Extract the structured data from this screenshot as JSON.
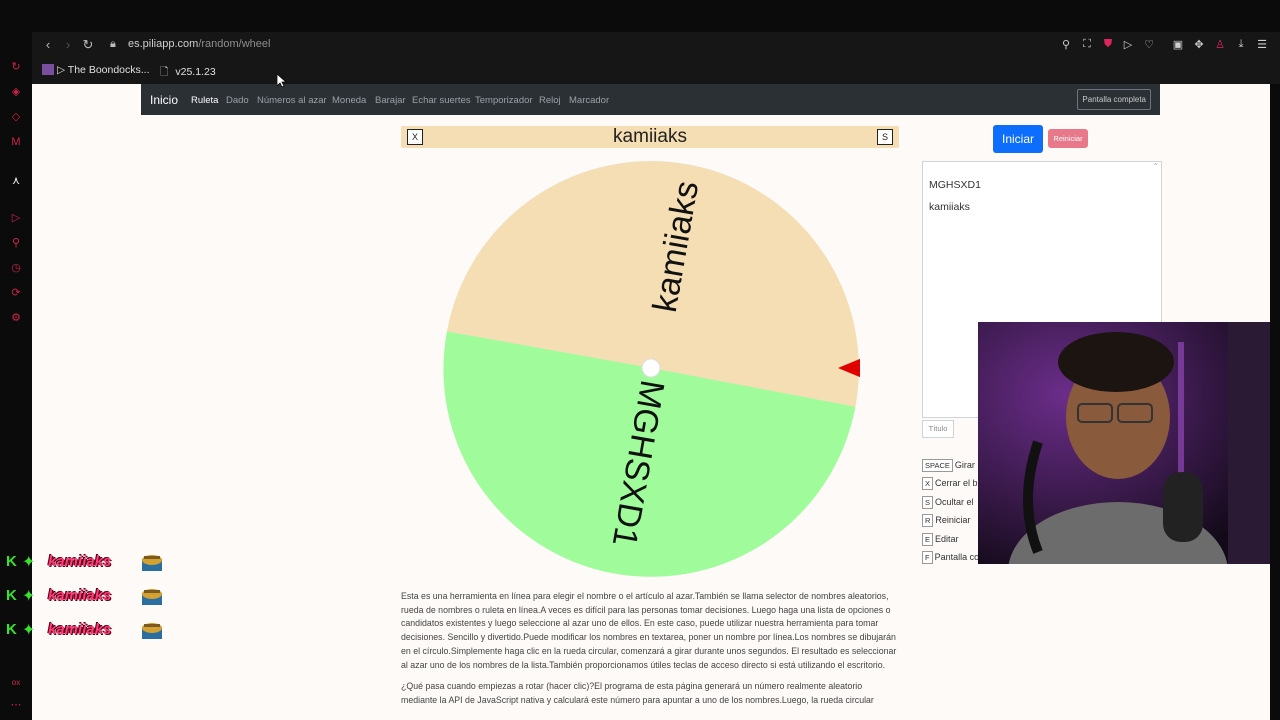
{
  "browser": {
    "url_domain": "es.piliapp.com",
    "url_path": "/random/wheel",
    "bookmarks": [
      {
        "label": "▷ The Boondocks..."
      },
      {
        "label": "v25.1.23"
      }
    ]
  },
  "nav": {
    "brand": "Inicio",
    "links": [
      "Ruleta",
      "Dado",
      "Números al azar",
      "Moneda",
      "Barajar",
      "Echar suertes",
      "Temporizador",
      "Reloj",
      "Marcador"
    ],
    "active": "Ruleta",
    "fullscreen_label": "Pantalla completa"
  },
  "wheel": {
    "title": "kamiiaks",
    "close_key": "X",
    "s_key": "S",
    "segments": [
      {
        "label": "kamiiaks",
        "color": "#f5deb3"
      },
      {
        "label": "MGHSXD1",
        "color": "#a0fc9b"
      }
    ],
    "pointer_color": "#e00000"
  },
  "controls": {
    "start_label": "Iniciar",
    "reset_label": "Reiniciar",
    "names": [
      "MGHSXD1",
      "kamiiaks"
    ],
    "title_placeholder": "Título",
    "shortcuts": [
      {
        "key": "SPACE",
        "label": "Girar"
      },
      {
        "key": "X",
        "label": "Cerrar el b"
      },
      {
        "key": "S",
        "label": "Ocultar el"
      },
      {
        "key": "R",
        "label": "Reiniciar"
      },
      {
        "key": "E",
        "label": "Editar"
      },
      {
        "key": "F",
        "label": "Pantalla co"
      }
    ]
  },
  "description": {
    "p1": "Esta es una herramienta en línea para elegir el nombre o el artículo al azar.También se llama selector de nombres aleatorios, rueda de nombres o ruleta en línea.A veces es difícil para las personas tomar decisiones. Luego haga una lista de opciones o candidatos existentes y luego seleccione al azar uno de ellos. En este caso, puede utilizar nuestra herramienta para tomar decisiones. Sencillo y divertido.Puede modificar los nombres en textarea, poner un nombre por línea.Los nombres se dibujarán en el círculo.Simplemente haga clic en la rueda circular, comenzará a girar durante unos segundos. El resultado es seleccionar al azar uno de los nombres de la lista.También proporcionamos útiles teclas de acceso directo si está utilizando el escritorio.",
    "p2": "¿Qué pasa cuando empiezas a rotar (hacer clic)?El programa de esta página generará un número realmente aleatorio mediante la API de JavaScript nativa y calculará este número para apuntar a uno de los nombres.Luego, la rueda circular"
  },
  "chat": [
    {
      "badge": "K",
      "user": "kamiiaks"
    },
    {
      "badge": "K",
      "user": "kamiiaks"
    },
    {
      "badge": "K",
      "user": "kamiiaks"
    }
  ]
}
